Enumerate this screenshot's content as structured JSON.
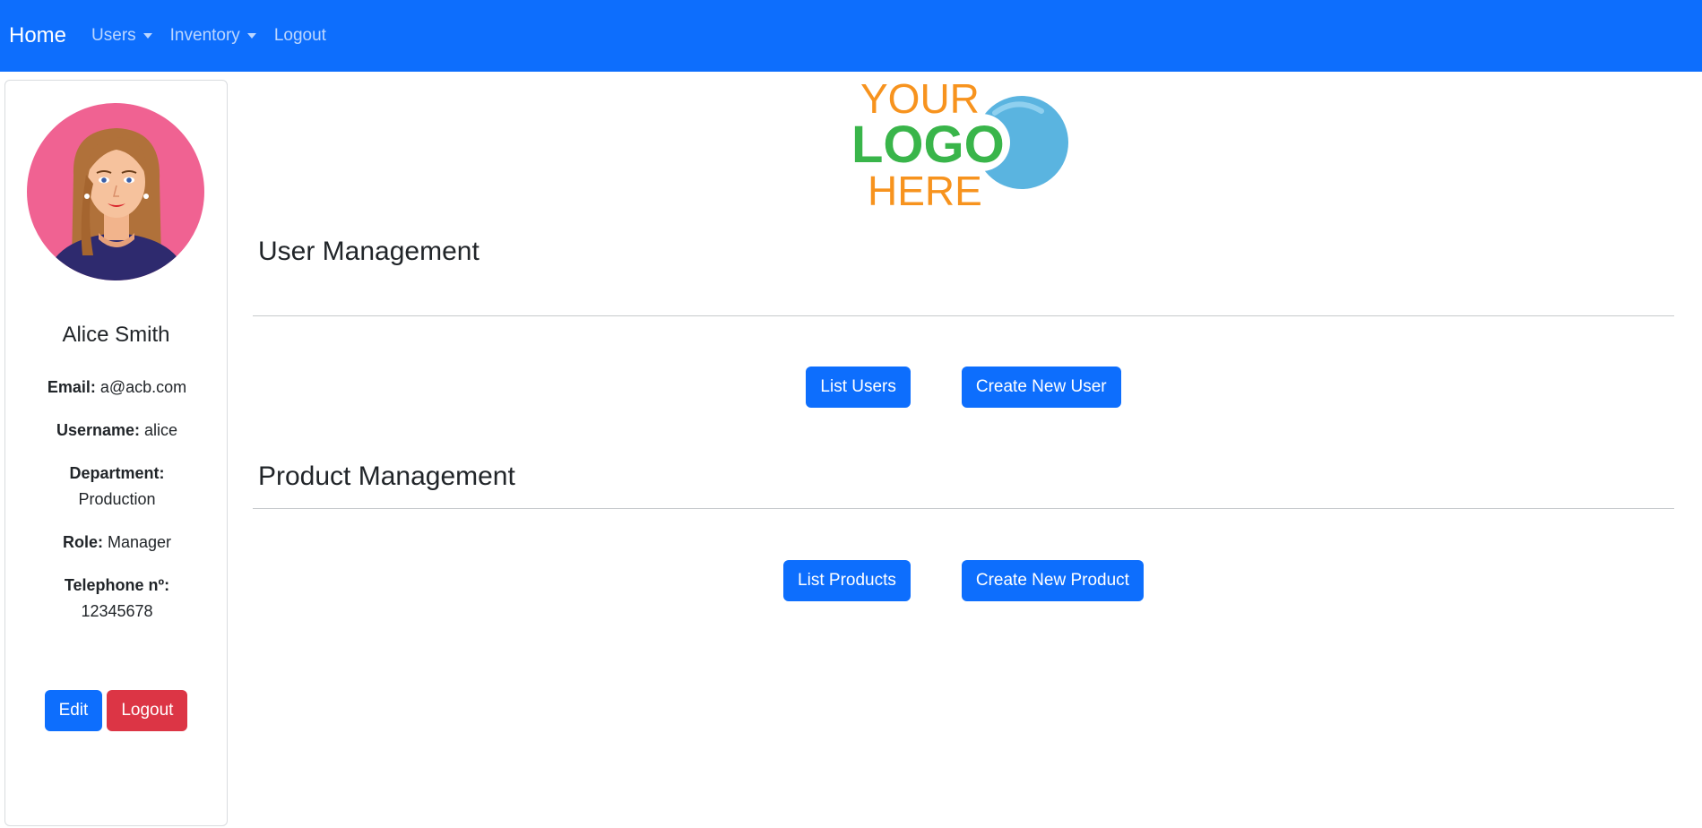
{
  "navbar": {
    "brand": "Home",
    "items": [
      {
        "label": "Users",
        "dropdown": true
      },
      {
        "label": "Inventory",
        "dropdown": true
      },
      {
        "label": "Logout",
        "dropdown": false
      }
    ],
    "background": "#0d6efd"
  },
  "profile": {
    "name": "Alice Smith",
    "email_label": "Email:",
    "email": "a@acb.com",
    "username_label": "Username:",
    "username": "alice",
    "department_label": "Department:",
    "department": "Production",
    "role_label": "Role:",
    "role": "Manager",
    "telephone_label": "Telephone nº:",
    "telephone": "12345678",
    "edit_label": "Edit",
    "logout_label": "Logout"
  },
  "logo": {
    "line1": "YOUR",
    "line2": "LOGO",
    "line3": "HERE"
  },
  "user_management": {
    "title": "User Management",
    "list_label": "List Users",
    "create_label": "Create New User"
  },
  "product_management": {
    "title": "Product Management",
    "list_label": "List Products",
    "create_label": "Create New Product"
  },
  "colors": {
    "primary": "#0d6efd",
    "danger": "#dc3545",
    "avatar_bg": "#f06292",
    "logo_orange": "#f7931e",
    "logo_green": "#39b54a",
    "logo_blue": "#5ab4e0"
  }
}
